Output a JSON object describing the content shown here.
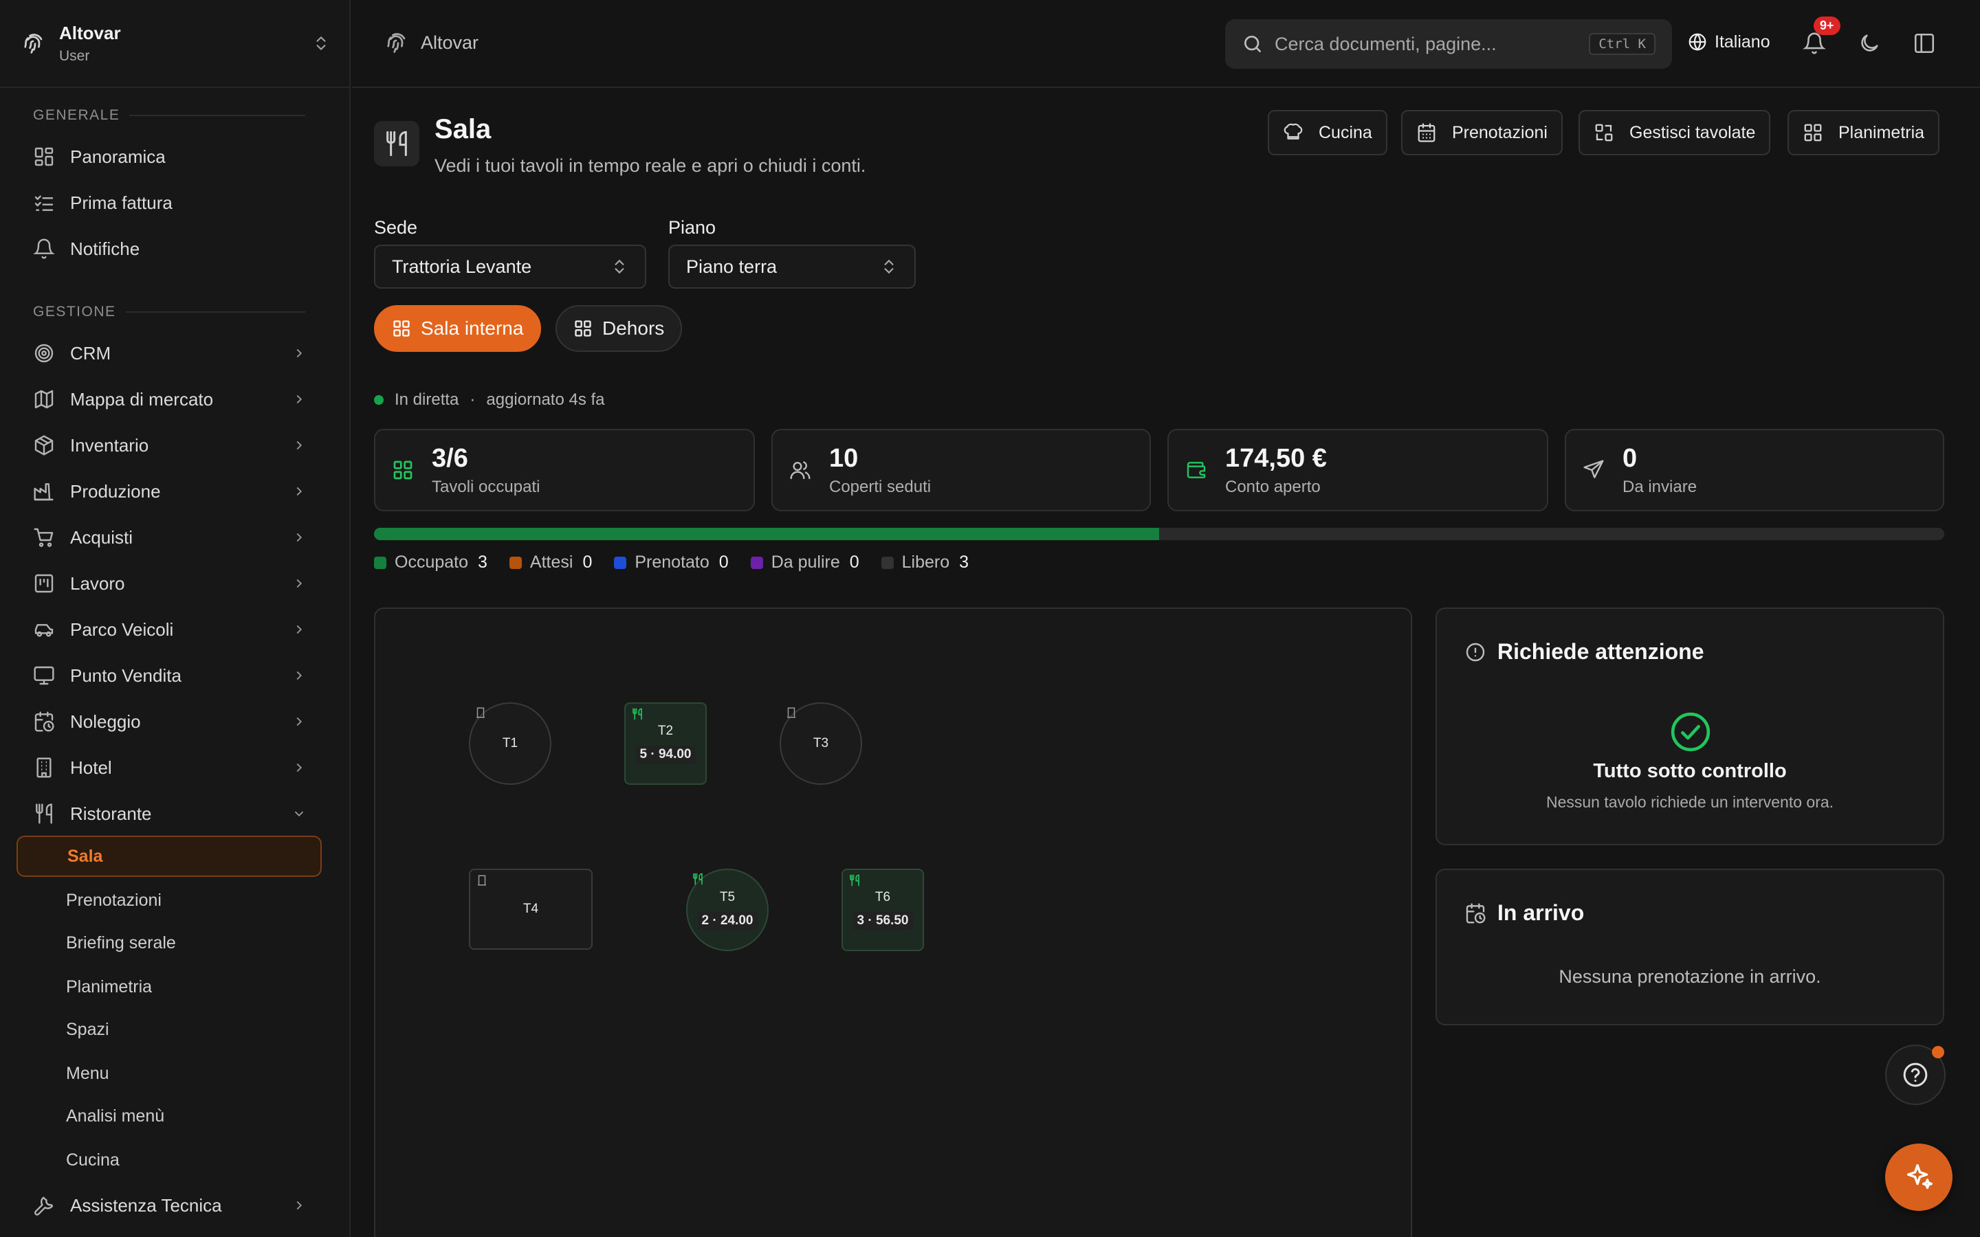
{
  "workspace": {
    "name": "Altovar",
    "role": "User"
  },
  "sidebar": {
    "sections": {
      "generale": "GENERALE",
      "gestione": "GESTIONE"
    },
    "generale_items": [
      {
        "label": "Panoramica",
        "icon": "dashboard-icon"
      },
      {
        "label": "Prima fattura",
        "icon": "list-check-icon"
      },
      {
        "label": "Notifiche",
        "icon": "bell-icon"
      }
    ],
    "gestione_items": [
      {
        "label": "CRM",
        "icon": "target-icon"
      },
      {
        "label": "Mappa di mercato",
        "icon": "map-icon"
      },
      {
        "label": "Inventario",
        "icon": "package-icon"
      },
      {
        "label": "Produzione",
        "icon": "factory-icon"
      },
      {
        "label": "Acquisti",
        "icon": "cart-icon"
      },
      {
        "label": "Lavoro",
        "icon": "kanban-icon"
      },
      {
        "label": "Parco Veicoli",
        "icon": "car-icon"
      },
      {
        "label": "Punto Vendita",
        "icon": "monitor-icon"
      },
      {
        "label": "Noleggio",
        "icon": "calendar-clock-icon"
      },
      {
        "label": "Hotel",
        "icon": "building-icon"
      },
      {
        "label": "Ristorante",
        "icon": "utensils-icon"
      }
    ],
    "ristorante_sub": [
      "Sala",
      "Prenotazioni",
      "Briefing serale",
      "Planimetria",
      "Spazi",
      "Menu",
      "Analisi menù",
      "Cucina"
    ],
    "footer_item": {
      "label": "Assistenza Tecnica",
      "icon": "wrench-icon"
    }
  },
  "topbar": {
    "breadcrumb": "Altovar",
    "search_placeholder": "Cerca documenti, pagine...",
    "search_shortcut": "Ctrl K",
    "language": "Italiano",
    "notifications_badge": "9+"
  },
  "page": {
    "title": "Sala",
    "subtitle": "Vedi i tuoi tavoli in tempo reale e apri o chiudi i conti.",
    "actions": [
      "Cucina",
      "Prenotazioni",
      "Gestisci tavolate",
      "Planimetria"
    ]
  },
  "filters": {
    "sede_label": "Sede",
    "sede_value": "Trattoria Levante",
    "piano_label": "Piano",
    "piano_value": "Piano terra",
    "areas": [
      "Sala interna",
      "Dehors"
    ]
  },
  "live": {
    "status": "In diretta",
    "updated": "aggiornato 4s fa"
  },
  "stats": [
    {
      "value": "3/6",
      "label": "Tavoli occupati",
      "icon": "grid-icon",
      "color": "#22c55e"
    },
    {
      "value": "10",
      "label": "Coperti seduti",
      "icon": "users-icon",
      "color": "#bdbdbd"
    },
    {
      "value": "174,50 €",
      "label": "Conto aperto",
      "icon": "wallet-icon",
      "color": "#22c55e"
    },
    {
      "value": "0",
      "label": "Da inviare",
      "icon": "send-icon",
      "color": "#bdbdbd"
    }
  ],
  "occupancy_fraction": 0.5,
  "legend": [
    {
      "label": "Occupato",
      "count": "3",
      "color": "#15803d"
    },
    {
      "label": "Attesi",
      "count": "0",
      "color": "#b45309"
    },
    {
      "label": "Prenotato",
      "count": "0",
      "color": "#1d4ed8"
    },
    {
      "label": "Da pulire",
      "count": "0",
      "color": "#6b21a8"
    },
    {
      "label": "Libero",
      "count": "3",
      "color": "#333333"
    }
  ],
  "tables": [
    {
      "name": "T1",
      "detail": "",
      "status": "libero",
      "shape": "round"
    },
    {
      "name": "T2",
      "detail": "5 · 94.00",
      "status": "occupato",
      "shape": "square"
    },
    {
      "name": "T3",
      "detail": "",
      "status": "libero",
      "shape": "round"
    },
    {
      "name": "T4",
      "detail": "",
      "status": "libero",
      "shape": "square"
    },
    {
      "name": "T5",
      "detail": "2 · 24.00",
      "status": "occupato",
      "shape": "round"
    },
    {
      "name": "T6",
      "detail": "3 · 56.50",
      "status": "occupato",
      "shape": "square"
    }
  ],
  "attention": {
    "title": "Richiede attenzione",
    "ok_title": "Tutto sotto controllo",
    "ok_text": "Nessun tavolo richiede un intervento ora."
  },
  "arrivals": {
    "title": "In arrivo",
    "empty": "Nessuna prenotazione in arrivo."
  },
  "colors": {
    "accent": "#e2641d",
    "success": "#22c55e"
  }
}
